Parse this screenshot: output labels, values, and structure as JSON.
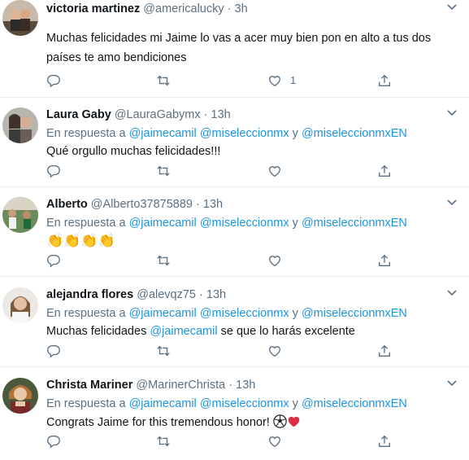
{
  "colors": {
    "muted": "#5b7083",
    "link": "#1b95e0",
    "text": "#0f1419",
    "divider": "#e6ecf0"
  },
  "tweets": [
    {
      "name": "victoria martinez",
      "handle": "@americalucky",
      "time": "3h",
      "reply_prefix": "",
      "m1": "",
      "m2": "",
      "and": "",
      "m3": "",
      "text_line1_a": "Muchas felicidades mi Jaime lo vas a acer muy bien pon en alto a tus dos",
      "text_line1_b": "",
      "text_line2": "países te amo bendiciones",
      "like_count": "1"
    },
    {
      "name": "Laura Gaby",
      "handle": "@LauraGabymx",
      "time": "13h",
      "reply_prefix": "En respuesta a",
      "m1": "@jaimecamil",
      "m2": "@miseleccionmx",
      "and": "y",
      "m3": "@miseleccionmxEN",
      "text_line1_a": "Qué orgullo muchas felicidades!!!",
      "text_line1_b": "",
      "text_line2": "",
      "like_count": ""
    },
    {
      "name": "Alberto",
      "handle": "@Alberto37875889",
      "time": "13h",
      "reply_prefix": "En respuesta a",
      "m1": "@jaimecamil",
      "m2": "@miseleccionmx",
      "and": "y",
      "m3": "@miseleccionmxEN",
      "text_line1_a": "👏👏👏👏",
      "text_line1_b": "",
      "text_line2": "",
      "like_count": ""
    },
    {
      "name": "alejandra flores",
      "handle": "@alevqz75",
      "time": "13h",
      "reply_prefix": "En respuesta a",
      "m1": "@jaimecamil",
      "m2": "@miseleccionmx",
      "and": "y",
      "m3": "@miseleccionmxEN",
      "text_line1_a": "Muchas felicidades",
      "text_mention": "@jaimecamil",
      "text_line1_b": "se que lo harás excelente",
      "text_line2": "",
      "like_count": ""
    },
    {
      "name": "Christa Mariner",
      "handle": "@MarinerChrista",
      "time": "13h",
      "reply_prefix": "En respuesta a",
      "m1": "@jaimecamil",
      "m2": "@miseleccionmx",
      "and": "y",
      "m3": "@miseleccionmxEN",
      "text_line1_a": "Congrats Jaime for this tremendous honor!",
      "text_line1_b": "",
      "text_line2": "",
      "like_count": ""
    }
  ],
  "dot": "·",
  "icons": [
    "reply-icon",
    "retweet-icon",
    "like-icon",
    "share-icon",
    "caret-down-icon",
    "soccer-ball-icon",
    "heart-emoji-icon"
  ]
}
